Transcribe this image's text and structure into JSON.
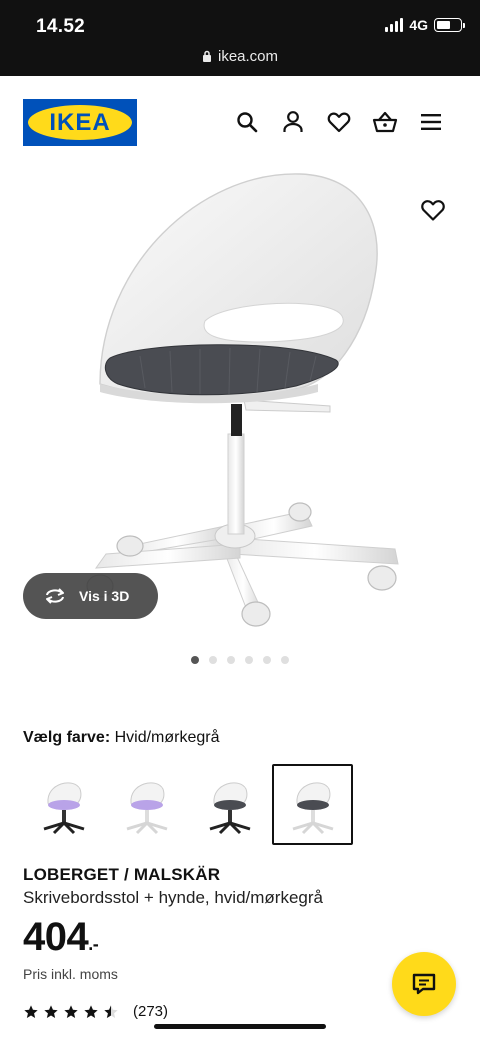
{
  "status_bar": {
    "time": "14.52",
    "network": "4G"
  },
  "browser": {
    "url": "ikea.com"
  },
  "header": {
    "logo_text": "IKEA",
    "icons": [
      "search-icon",
      "account-icon",
      "heart-icon",
      "basket-icon",
      "menu-icon"
    ]
  },
  "gallery": {
    "view_3d_label": "Vis i 3D",
    "image_count": 6,
    "active_index": 0
  },
  "color": {
    "label": "Vælg farve:",
    "value": "Hvid/mørkegrå",
    "swatch_count": 4,
    "selected_index": 3
  },
  "product": {
    "name": "LOBERGET / MALSKÄR",
    "description": "Skrivebordsstol + hynde, hvid/mørkegrå",
    "price": "404",
    "price_suffix": ".-",
    "vat_note": "Pris inkl. moms",
    "rating_stars": 4.5,
    "review_count": "(273)"
  },
  "colors": {
    "ikea_blue": "#0051ba",
    "ikea_yellow": "#ffda1a",
    "text": "#111111"
  }
}
